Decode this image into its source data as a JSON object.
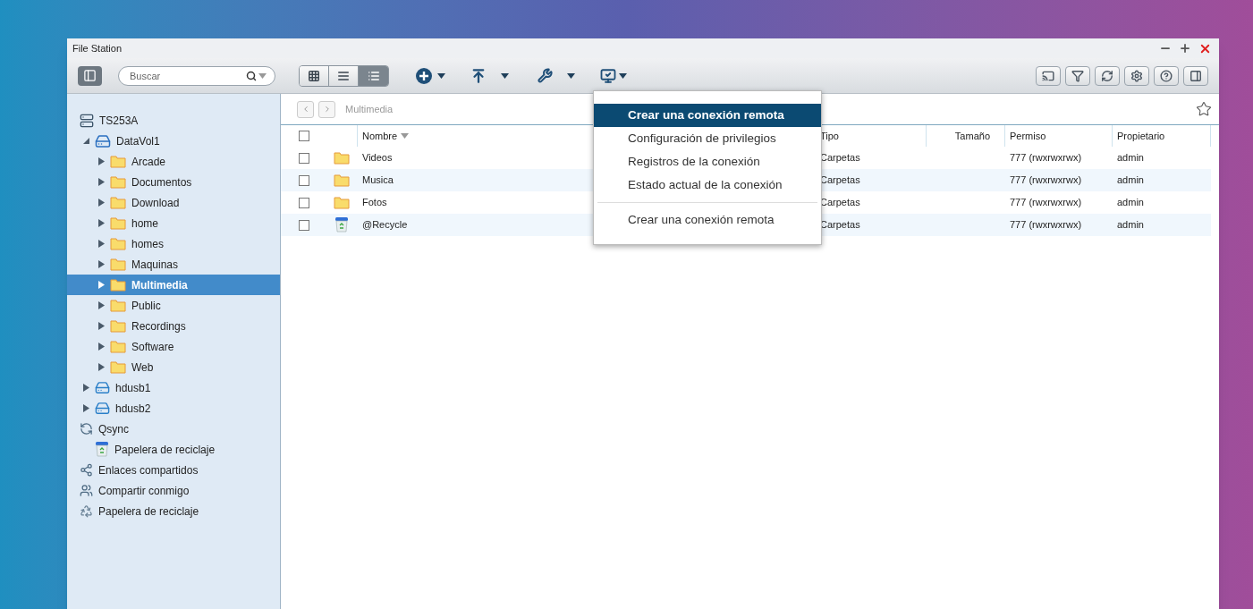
{
  "window": {
    "title": "File Station"
  },
  "toolbar": {
    "search": {
      "placeholder": "Buscar"
    },
    "view_modes": [
      {
        "kind": "grid",
        "selected": false
      },
      {
        "kind": "list",
        "selected": false
      },
      {
        "kind": "details",
        "selected": true
      }
    ]
  },
  "sidebar": {
    "items": [
      {
        "label": "TS253A",
        "kind": "server",
        "selected": false,
        "children": [
          {
            "label": "DataVol1",
            "kind": "volume",
            "expanded": true,
            "selected": false,
            "children": [
              {
                "label": "Arcade",
                "kind": "folder",
                "expanded": false,
                "selected": false
              },
              {
                "label": "Documentos",
                "kind": "folder",
                "expanded": false,
                "selected": false
              },
              {
                "label": "Download",
                "kind": "folder",
                "expanded": false,
                "selected": false
              },
              {
                "label": "home",
                "kind": "folder",
                "expanded": false,
                "selected": false
              },
              {
                "label": "homes",
                "kind": "folder",
                "expanded": false,
                "selected": false
              },
              {
                "label": "Maquinas",
                "kind": "folder",
                "expanded": false,
                "selected": false
              },
              {
                "label": "Multimedia",
                "kind": "folder",
                "expanded": false,
                "selected": true
              },
              {
                "label": "Public",
                "kind": "folder",
                "expanded": false,
                "selected": false
              },
              {
                "label": "Recordings",
                "kind": "folder",
                "expanded": false,
                "selected": false
              },
              {
                "label": "Software",
                "kind": "folder",
                "expanded": false,
                "selected": false
              },
              {
                "label": "Web",
                "kind": "folder",
                "expanded": false,
                "selected": false
              }
            ]
          },
          {
            "label": "hdusb1",
            "kind": "usb",
            "expanded": false,
            "selected": false
          },
          {
            "label": "hdusb2",
            "kind": "usb",
            "expanded": false,
            "selected": false
          }
        ]
      },
      {
        "label": "Qsync",
        "kind": "qsync",
        "selected": false,
        "children": [
          {
            "label": "Papelera de reciclaje",
            "kind": "recycle",
            "selected": false
          }
        ]
      },
      {
        "label": "Enlaces compartidos",
        "kind": "share",
        "selected": false
      },
      {
        "label": "Compartir conmigo",
        "kind": "shared",
        "selected": false
      },
      {
        "label": "Papelera de reciclaje",
        "kind": "trash",
        "selected": false
      }
    ]
  },
  "breadcrumb": "Multimedia",
  "table": {
    "select_all": {
      "checked": false
    },
    "columns": [
      "Nombre",
      "Tipo",
      "Tamaño",
      "Permiso",
      "Propietario"
    ],
    "rows": [
      {
        "name": "Videos",
        "kind": "folder",
        "type": "Carpetas",
        "permission": "777 (rwxrwxrwx)",
        "owner": "admin",
        "checked": false
      },
      {
        "name": "Musica",
        "kind": "folder",
        "type": "Carpetas",
        "permission": "777 (rwxrwxrwx)",
        "owner": "admin",
        "checked": false
      },
      {
        "name": "Fotos",
        "kind": "folder",
        "type": "Carpetas",
        "permission": "777 (rwxrwxrwx)",
        "owner": "admin",
        "checked": false
      },
      {
        "name": "@Recycle",
        "kind": "recycle",
        "type": "Carpetas",
        "permission": "777 (rwxrwxrwx)",
        "owner": "admin",
        "checked": false
      }
    ]
  },
  "menu": {
    "sections": [
      [
        {
          "label": "Crear una conexión remota",
          "selected": true
        },
        {
          "label": "Configuración de privilegios",
          "selected": false
        },
        {
          "label": "Registros de la conexión",
          "selected": false
        },
        {
          "label": "Estado actual de la conexión",
          "selected": false
        }
      ],
      [
        {
          "label": "Crear una conexión remota",
          "selected": false
        }
      ]
    ]
  }
}
